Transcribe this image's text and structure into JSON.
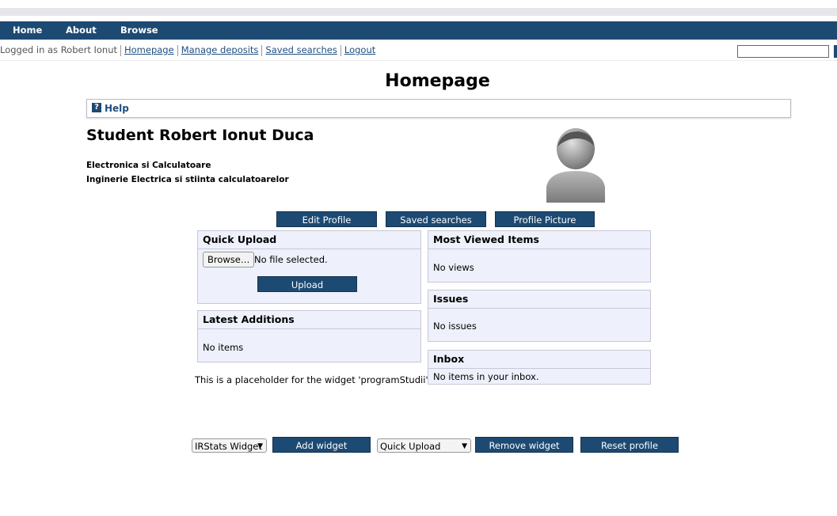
{
  "nav": {
    "home": "Home",
    "about": "About",
    "browse": "Browse"
  },
  "login": {
    "status": "Logged in as Robert Ionut",
    "homepage": "Homepage",
    "manage_deposits": "Manage deposits",
    "saved_searches": "Saved searches",
    "logout": "Logout"
  },
  "page": {
    "title": "Homepage"
  },
  "help": {
    "label": "Help",
    "icon": "?"
  },
  "profile": {
    "name": "Student Robert Ionut Duca",
    "affiliation1": "Electronica si Calculatoare",
    "affiliation2": "Inginerie Electrica si stiinta calculatoarelor"
  },
  "profile_buttons": {
    "edit": "Edit Profile",
    "saved": "Saved searches",
    "picture": "Profile Picture"
  },
  "quick_upload": {
    "title": "Quick Upload",
    "browse": "Browse…",
    "no_file": "No file selected.",
    "upload": "Upload"
  },
  "latest": {
    "title": "Latest Additions",
    "empty": "No items"
  },
  "most_viewed": {
    "title": "Most Viewed Items",
    "empty": "No views"
  },
  "issues": {
    "title": "Issues",
    "empty": "No issues"
  },
  "inbox": {
    "title": "Inbox",
    "empty": "No items in your inbox."
  },
  "placeholder": "This is a placeholder for the widget 'programStudii'",
  "widgets": {
    "add_select": "IRStats Widget",
    "add_button": "Add widget",
    "remove_select": "Quick Upload",
    "remove_button": "Remove widget",
    "reset_button": "Reset profile"
  },
  "colors": {
    "nav_bg": "#1d4a72",
    "box_bg": "#eef0fb",
    "link": "#1f4f80"
  }
}
